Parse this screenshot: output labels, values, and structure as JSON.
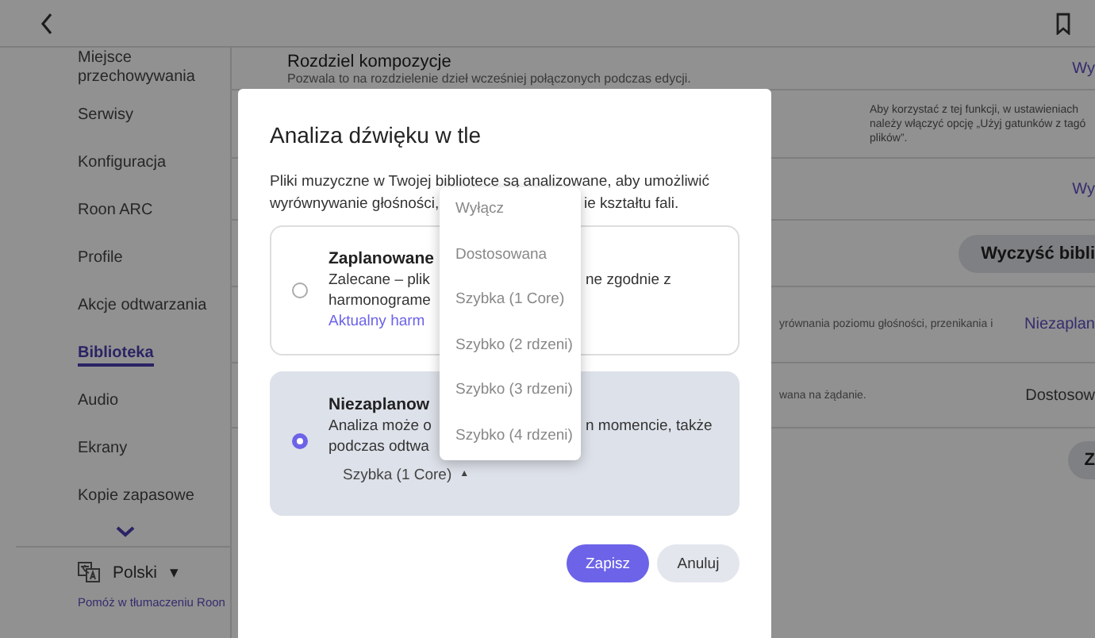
{
  "sidebar": {
    "items": [
      {
        "label": "Miejsce przechowywania",
        "selected": false
      },
      {
        "label": "Serwisy",
        "selected": false
      },
      {
        "label": "Konfiguracja",
        "selected": false
      },
      {
        "label": "Roon ARC",
        "selected": false
      },
      {
        "label": "Profile",
        "selected": false
      },
      {
        "label": "Akcje odtwarzania",
        "selected": false
      },
      {
        "label": "Biblioteka",
        "selected": true
      },
      {
        "label": "Audio",
        "selected": false
      },
      {
        "label": "Ekrany",
        "selected": false
      },
      {
        "label": "Kopie zapasowe",
        "selected": false
      }
    ],
    "language": "Polski",
    "language_caret": "▾",
    "help_link": "Pomóż w tłumaczeniu Roon"
  },
  "settings": [
    {
      "kind": "heading",
      "title": "Rozdziel kompozycje",
      "description": "Pozwala to na rozdzielenie dzieł wcześniej połączonych podczas edycji.",
      "action": "Wy"
    },
    {
      "kind": "note",
      "description": "Aby korzystać z tej funkcji, w ustawieniach\nnależy włączyć opcję „Użyj gatunków z tagó\nplików”."
    },
    {
      "kind": "link",
      "action": "Wy"
    },
    {
      "kind": "button",
      "action": "Wyczyść bibli"
    },
    {
      "kind": "link",
      "description": "yrównania poziomu głośności, przenikania i",
      "action": "Niezaplan"
    },
    {
      "kind": "value",
      "description": "wana na żądanie.",
      "action": "Dostosow"
    },
    {
      "kind": "button",
      "action": "Z"
    }
  ],
  "dialog": {
    "title": "Analiza dźwięku w tle",
    "description_line_1": "Pliki muzyczne w Twojej bibliotece są analizowane, aby umożliwić",
    "description_line_2_left": "wyrównywanie głośności,",
    "description_line_2_right": "ie kształtu fali.",
    "options": [
      {
        "title": "Zaplanowane",
        "lines": [
          {
            "left": "Zalecane – plik",
            "right": "ne zgodnie z"
          },
          {
            "left": "harmonograme"
          }
        ],
        "link": "Aktualny harm",
        "selected": false
      },
      {
        "title": "Niezaplanow",
        "lines": [
          {
            "left": "Analiza może o",
            "right": "n momencie, także"
          },
          {
            "left": "podczas odtwa"
          }
        ],
        "speed": {
          "value": "Szybka (1 Core)",
          "caret": "▲"
        },
        "selected": true
      }
    ],
    "menu": [
      "Wyłącz",
      "Dostosowana",
      "Szybka (1 Core)",
      "Szybko (2 rdzeni)",
      "Szybko (3 rdzeni)",
      "Szybko (4 rdzeni)"
    ],
    "buttons": [
      {
        "label": "Zapisz",
        "kind": "primary"
      },
      {
        "label": "Anuluj",
        "kind": "secondary"
      }
    ]
  }
}
